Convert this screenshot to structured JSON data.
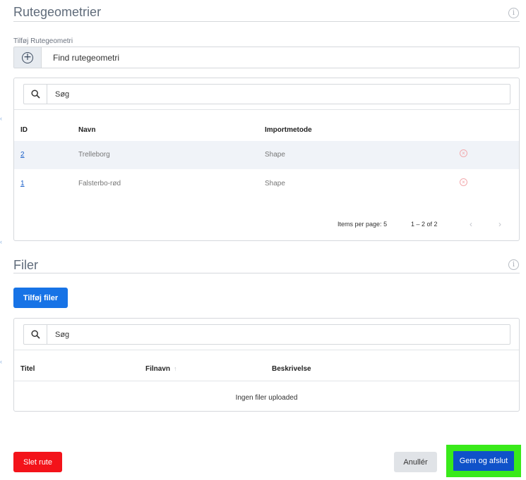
{
  "route_geometries": {
    "title": "Rutegeometrier",
    "add_label": "Tilføj Rutegeometri",
    "find_placeholder": "Find rutegeometri",
    "search_placeholder": "Søg",
    "columns": {
      "id": "ID",
      "name": "Navn",
      "import_method": "Importmetode"
    },
    "rows": [
      {
        "id": "2",
        "name": "Trelleborg",
        "import_method": "Shape"
      },
      {
        "id": "1",
        "name": "Falsterbo-rød",
        "import_method": "Shape"
      }
    ],
    "paginator": {
      "items_per_page_label": "Items per page:",
      "items_per_page": "5",
      "range": "1 – 2 of 2"
    }
  },
  "files": {
    "title": "Filer",
    "add_button": "Tilføj filer",
    "search_placeholder": "Søg",
    "columns": {
      "title": "Titel",
      "filename": "Filnavn",
      "description": "Beskrivelse"
    },
    "empty_message": "Ingen filer uploaded"
  },
  "footer": {
    "delete_button": "Slet rute",
    "cancel_button": "Anullér",
    "save_button": "Gem og afslut"
  },
  "colors": {
    "primary": "#1773e6",
    "danger": "#f3131a",
    "save": "#0f52c9",
    "highlight": "#39ea1a"
  }
}
